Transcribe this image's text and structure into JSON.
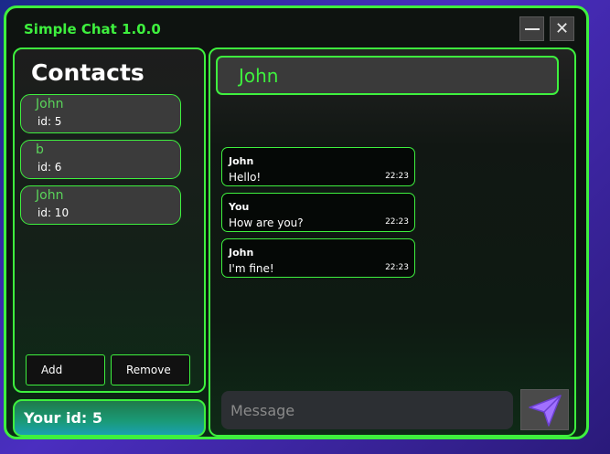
{
  "window": {
    "title": "Simple Chat 1.0.0",
    "minimize_glyph": "—",
    "close_glyph": "✕"
  },
  "contacts": {
    "title": "Contacts",
    "items": [
      {
        "name": "John",
        "id": "id: 5"
      },
      {
        "name": "b",
        "id": "id: 6"
      },
      {
        "name": "John",
        "id": "id: 10"
      }
    ],
    "add_label": "Add",
    "remove_label": "Remove"
  },
  "your_id": "Your id: 5",
  "chat": {
    "header": "John",
    "messages": [
      {
        "author": "John",
        "text": "Hello!",
        "time": "22:23"
      },
      {
        "author": "You",
        "text": "How are you?",
        "time": "22:23"
      },
      {
        "author": "John",
        "text": "I'm fine!",
        "time": "22:23"
      }
    ],
    "input": {
      "value": "",
      "placeholder": "Message"
    },
    "send_icon": "send-icon"
  },
  "colors": {
    "accent": "#3ef03e",
    "send_icon": "#a070ff"
  }
}
